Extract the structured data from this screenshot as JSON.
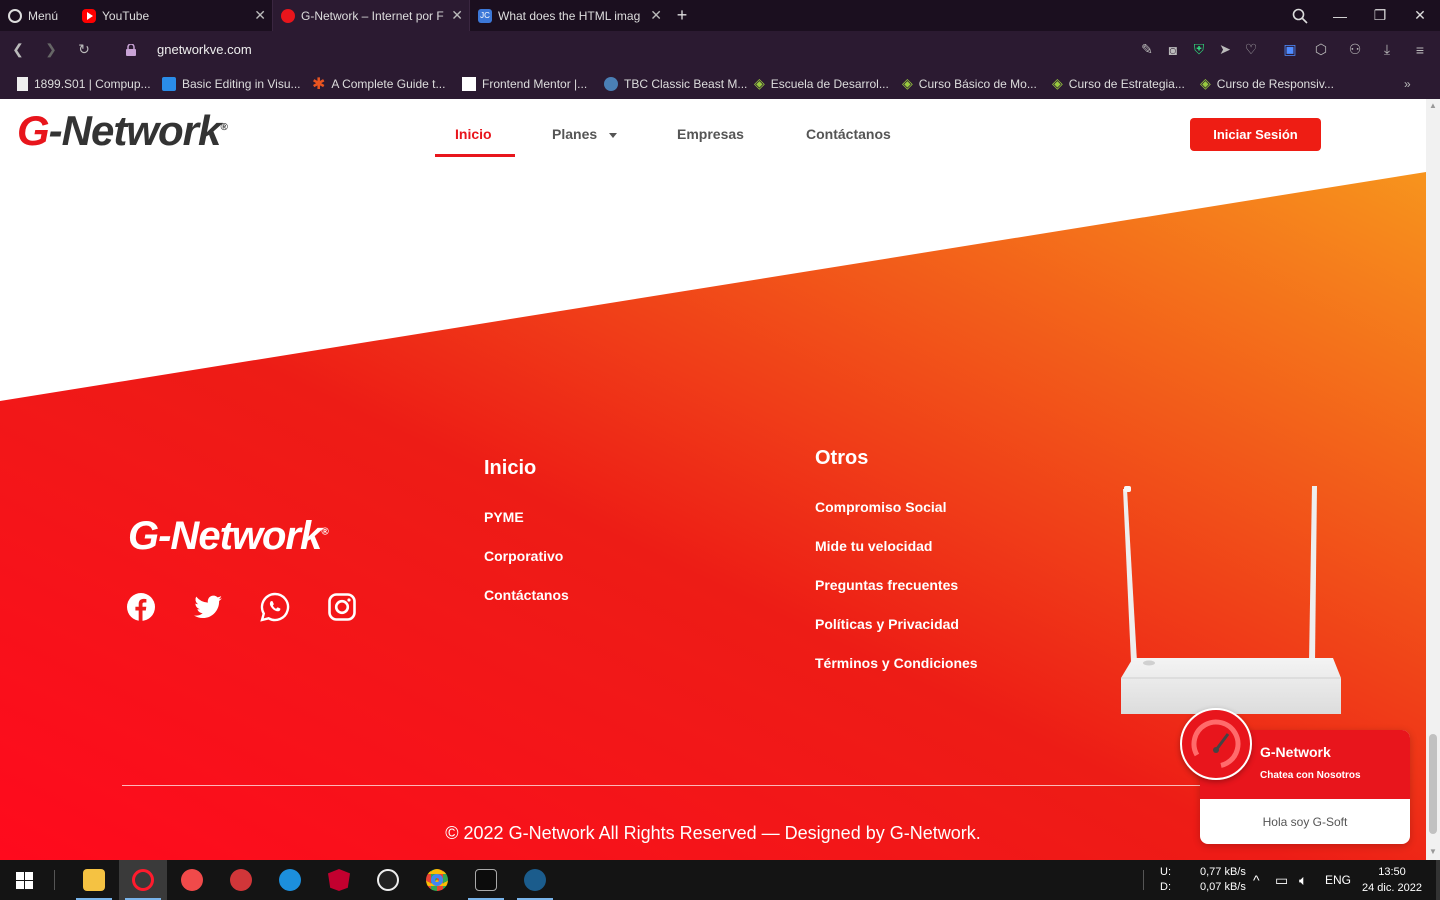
{
  "browser": {
    "menu_label": "Menú",
    "tabs": [
      {
        "label": "YouTube"
      },
      {
        "label": "G-Network – Internet por F"
      },
      {
        "label": "What does the HTML imag"
      }
    ],
    "url": "gnetworkve.com",
    "bookmarks": [
      "1899.S01 | Compup...",
      "Basic Editing in Visu...",
      "A Complete Guide t...",
      "Frontend Mentor |...",
      "TBC Classic Beast M...",
      "Escuela de Desarrol...",
      "Curso Básico de Mo...",
      "Curso de Estrategia...",
      "Curso de Responsiv..."
    ]
  },
  "header": {
    "logo": "G-Network",
    "nav": [
      "Inicio",
      "Planes",
      "Empresas",
      "Contáctanos"
    ],
    "login": "Iniciar Sesión"
  },
  "footer": {
    "logo": "G-Network",
    "col1": {
      "title": "Inicio",
      "links": [
        "PYME",
        "Corporativo",
        "Contáctanos"
      ]
    },
    "col2": {
      "title": "Otros",
      "links": [
        "Compromiso Social",
        "Mide tu velocidad",
        "Preguntas frecuentes",
        "Políticas y Privacidad",
        "Términos y Condiciones"
      ]
    },
    "copyright": "© 2022 G-Network All Rights Reserved — Designed by G-Network."
  },
  "chat": {
    "name": "G-Network",
    "subtitle": "Chatea con Nosotros",
    "message": "Hola soy G-Soft"
  },
  "taskbar": {
    "upload": "U:",
    "download": "D:",
    "up_speed": "0,77 kB/s",
    "down_speed": "0,07 kB/s",
    "lang": "ENG",
    "time": "13:50",
    "date": "24 dic. 2022"
  },
  "colors": {
    "brand_red": "#e8151c",
    "brand_orange": "#f7941d"
  }
}
